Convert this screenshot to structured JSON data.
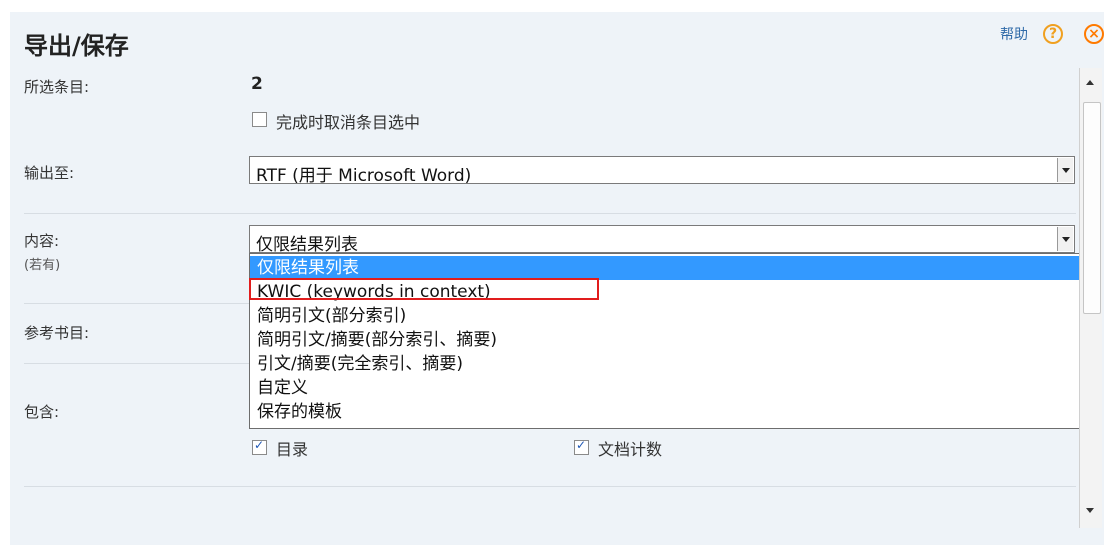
{
  "header": {
    "title": "导出/保存",
    "help_label": "帮助",
    "help_icon": "question-circle",
    "close_icon": "close-circle"
  },
  "selected_items": {
    "label": "所选条目:",
    "count": "2",
    "deselect_checkbox_label": "完成时取消条目选中",
    "deselect_checked": false
  },
  "output": {
    "label": "输出至:",
    "selected": "RTF (用于 Microsoft Word)"
  },
  "content": {
    "label": "内容:",
    "sublabel": "(若有)",
    "selected": "仅限结果列表",
    "options": [
      "仅限结果列表",
      "KWIC (keywords in context)",
      "简明引文(部分索引)",
      "简明引文/摘要(部分索引、摘要)",
      "引文/摘要(完全索引、摘要)",
      "自定义",
      "保存的模板"
    ]
  },
  "bibliography": {
    "label": "参考书目:"
  },
  "include": {
    "label": "包含:",
    "toc_label": "目录",
    "toc_checked": true,
    "doc_count_label": "文档计数",
    "doc_count_checked": true
  },
  "colors": {
    "panel_bg": "#eef3f8",
    "highlight": "#3399ff",
    "annotation": "#e11d1d",
    "close": "#ff7a00"
  }
}
